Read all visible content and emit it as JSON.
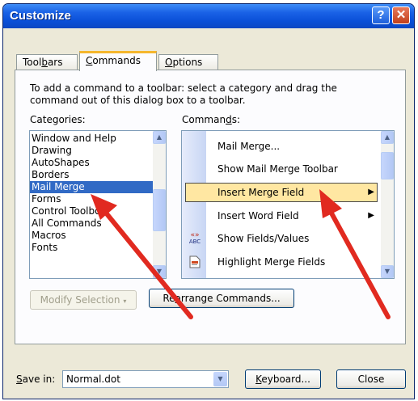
{
  "window": {
    "title": "Customize"
  },
  "tabs": [
    {
      "label_pre": "Tool",
      "label_key": "b",
      "label_post": "ars"
    },
    {
      "label_pre": "",
      "label_key": "C",
      "label_post": "ommands"
    },
    {
      "label_pre": "",
      "label_key": "O",
      "label_post": "ptions"
    }
  ],
  "instructions": "To add a command to a toolbar: select a category and drag the command out of this dialog box to a toolbar.",
  "categories": {
    "label": "Categories:",
    "items": [
      "Window and Help",
      "Drawing",
      "AutoShapes",
      "Borders",
      "Mail Merge",
      "Forms",
      "Control Toolbox",
      "All Commands",
      "Macros",
      "Fonts"
    ],
    "selected": "Mail Merge"
  },
  "commands": {
    "label_pre": "Comman",
    "label_key": "d",
    "label_post": "s:",
    "items": [
      {
        "label": "Mail Merge...",
        "icon": "",
        "submenu": false
      },
      {
        "label": "Show Mail Merge Toolbar",
        "icon": "",
        "submenu": false
      },
      {
        "label": "Insert Merge Field",
        "icon": "",
        "submenu": true
      },
      {
        "label": "Insert Word Field",
        "icon": "",
        "submenu": true
      },
      {
        "label": "Show Fields/Values",
        "icon": "field-codes-icon",
        "submenu": false
      },
      {
        "label": "Highlight Merge Fields",
        "icon": "highlight-document-icon",
        "submenu": false
      }
    ],
    "highlighted": "Insert Merge Field",
    "field_codes_glyph_top": "«»",
    "field_codes_glyph_bottom": "ABC"
  },
  "buttons": {
    "modify_selection": "Modify Selection",
    "rearrange_pre": "Re",
    "rearrange_key": "a",
    "rearrange_post": "rrange Commands...",
    "keyboard_pre": "",
    "keyboard_key": "K",
    "keyboard_post": "eyboard...",
    "close": "Close"
  },
  "save_in": {
    "label_pre": "",
    "label_key": "S",
    "label_post": "ave in:",
    "value": "Normal.dot"
  },
  "colors": {
    "title_bar": "#0a4fd8",
    "selection": "#316ac5",
    "highlight": "#ffe7a2",
    "annotation_arrow": "#e12a20"
  }
}
